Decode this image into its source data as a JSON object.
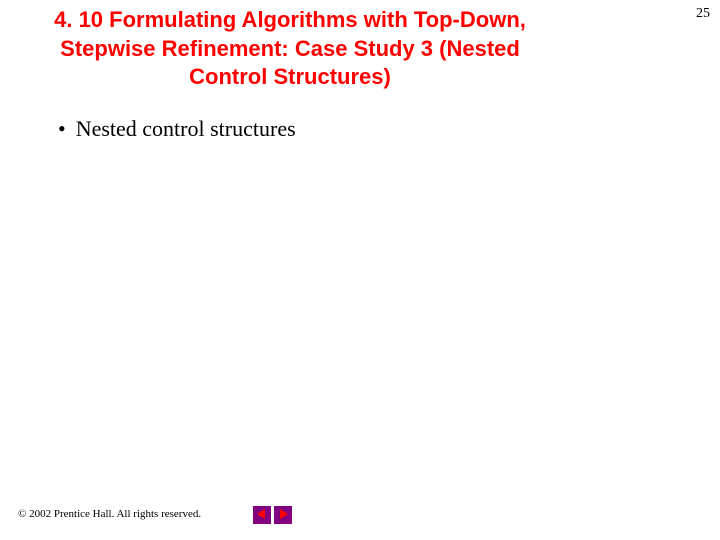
{
  "slide": {
    "title": "4. 10   Formulating Algorithms with Top-Down, Stepwise Refinement: Case Study 3 (Nested Control Structures)",
    "page_number": "25"
  },
  "bullets": [
    {
      "marker": "•",
      "text": "Nested control structures"
    }
  ],
  "footer": {
    "copyright": "© 2002 Prentice Hall. All rights reserved."
  },
  "nav": {
    "prev_label": "previous",
    "next_label": "next"
  },
  "colors": {
    "title_color": "#ff0000",
    "nav_bg": "#800080"
  }
}
